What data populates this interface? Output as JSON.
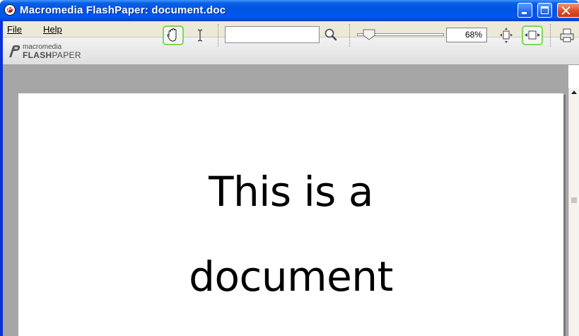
{
  "window": {
    "title": "Macromedia FlashPaper: document.doc"
  },
  "menu": {
    "items": [
      {
        "label": "File"
      },
      {
        "label": "Help"
      }
    ]
  },
  "toolbar": {
    "logo_top": "macromedia",
    "logo_bold": "FLASH",
    "logo_rest": "PAPER",
    "search_value": "",
    "zoom_level": "68%",
    "zoom_fraction": 0.14
  },
  "document": {
    "lines": [
      "This is a",
      "document"
    ]
  },
  "icons": {
    "app": "flashpaper-icon",
    "hand": "hand-tool-icon",
    "text": "text-select-icon",
    "search": "magnifier-icon",
    "fit_page": "fit-page-icon",
    "fit_width": "fit-width-icon",
    "print": "printer-icon"
  },
  "colors": {
    "title_bar": "#0054e3",
    "active_tool_outline": "#7ed957",
    "doc_background": "#a6a6a6",
    "close_button": "#e0512a"
  }
}
